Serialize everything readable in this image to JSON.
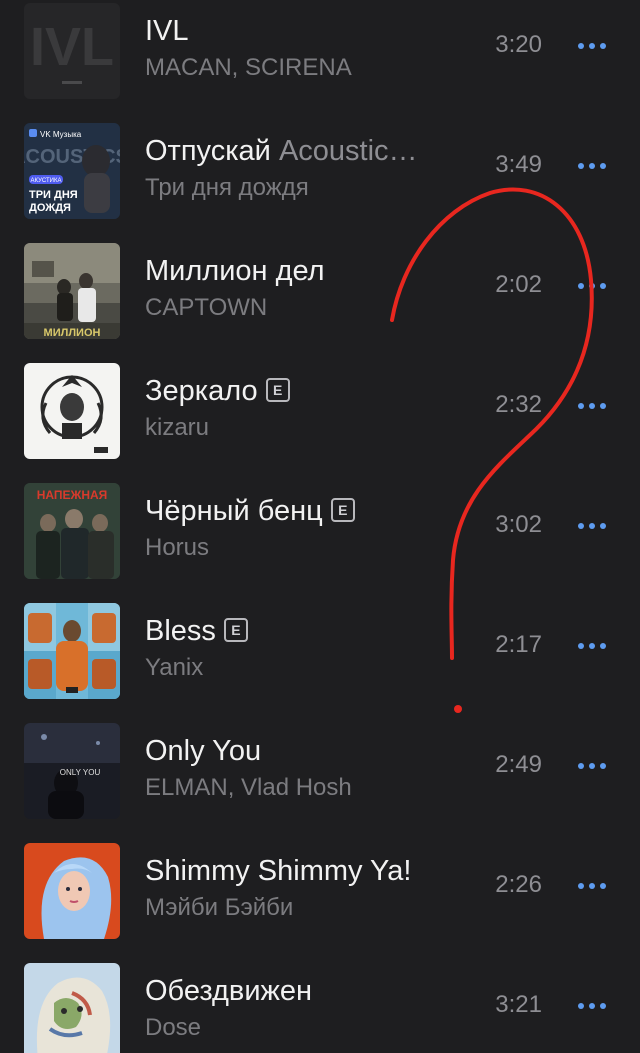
{
  "tracks": [
    {
      "title": "IVL",
      "subtitle": "",
      "explicit": false,
      "artist": "MACAN, SCIRENA",
      "duration": "3:20",
      "cover_icon": "ivl-cover",
      "cover_text": "IVL"
    },
    {
      "title": "Отпускай",
      "subtitle": "Acoustic…",
      "explicit": false,
      "artist": "Три дня дождя",
      "duration": "3:49",
      "cover_icon": "acoustic-cover",
      "cover_text": "ТРИ ДНЯ ДОЖДЯ",
      "cover_badge": "VK Музыка",
      "cover_tag": "АКУСТИКА",
      "cover_bg_text": "ACOUSTICS"
    },
    {
      "title": "Миллион дел",
      "subtitle": "",
      "explicit": false,
      "artist": "CAPTOWN",
      "duration": "2:02",
      "cover_icon": "street-photo-cover"
    },
    {
      "title": "Зеркало",
      "subtitle": "",
      "explicit": true,
      "explicit_label": "E",
      "artist": "kizaru",
      "duration": "2:32",
      "cover_icon": "crest-cover"
    },
    {
      "title": "Чёрный бенц",
      "subtitle": "",
      "explicit": true,
      "explicit_label": "E",
      "artist": "Horus",
      "duration": "3:02",
      "cover_icon": "group-photo-cover",
      "cover_text": "НАПЕЖНАЯ"
    },
    {
      "title": "Bless",
      "subtitle": "",
      "explicit": true,
      "explicit_label": "E",
      "artist": "Yanix",
      "duration": "2:17",
      "cover_icon": "collage-cover"
    },
    {
      "title": "Only You",
      "subtitle": "",
      "explicit": false,
      "artist": "ELMAN, Vlad Hosh",
      "duration": "2:49",
      "cover_icon": "night-portrait-cover",
      "cover_text": "ONLY YOU"
    },
    {
      "title": "Shimmy Shimmy Ya!",
      "subtitle": "",
      "explicit": false,
      "artist": "Мэйби Бэйби",
      "duration": "2:26",
      "cover_icon": "blue-hair-cover"
    },
    {
      "title": "Обездвижен",
      "subtitle": "",
      "explicit": false,
      "artist": "Dose",
      "duration": "3:21",
      "cover_icon": "painting-cover"
    }
  ],
  "more_icon": "more-dots-icon",
  "colors": {
    "background": "#1e1e20",
    "title": "#f2f2f2",
    "secondary": "#8e8e93",
    "accent": "#5e9cf0",
    "annotation": "#e8271f"
  }
}
